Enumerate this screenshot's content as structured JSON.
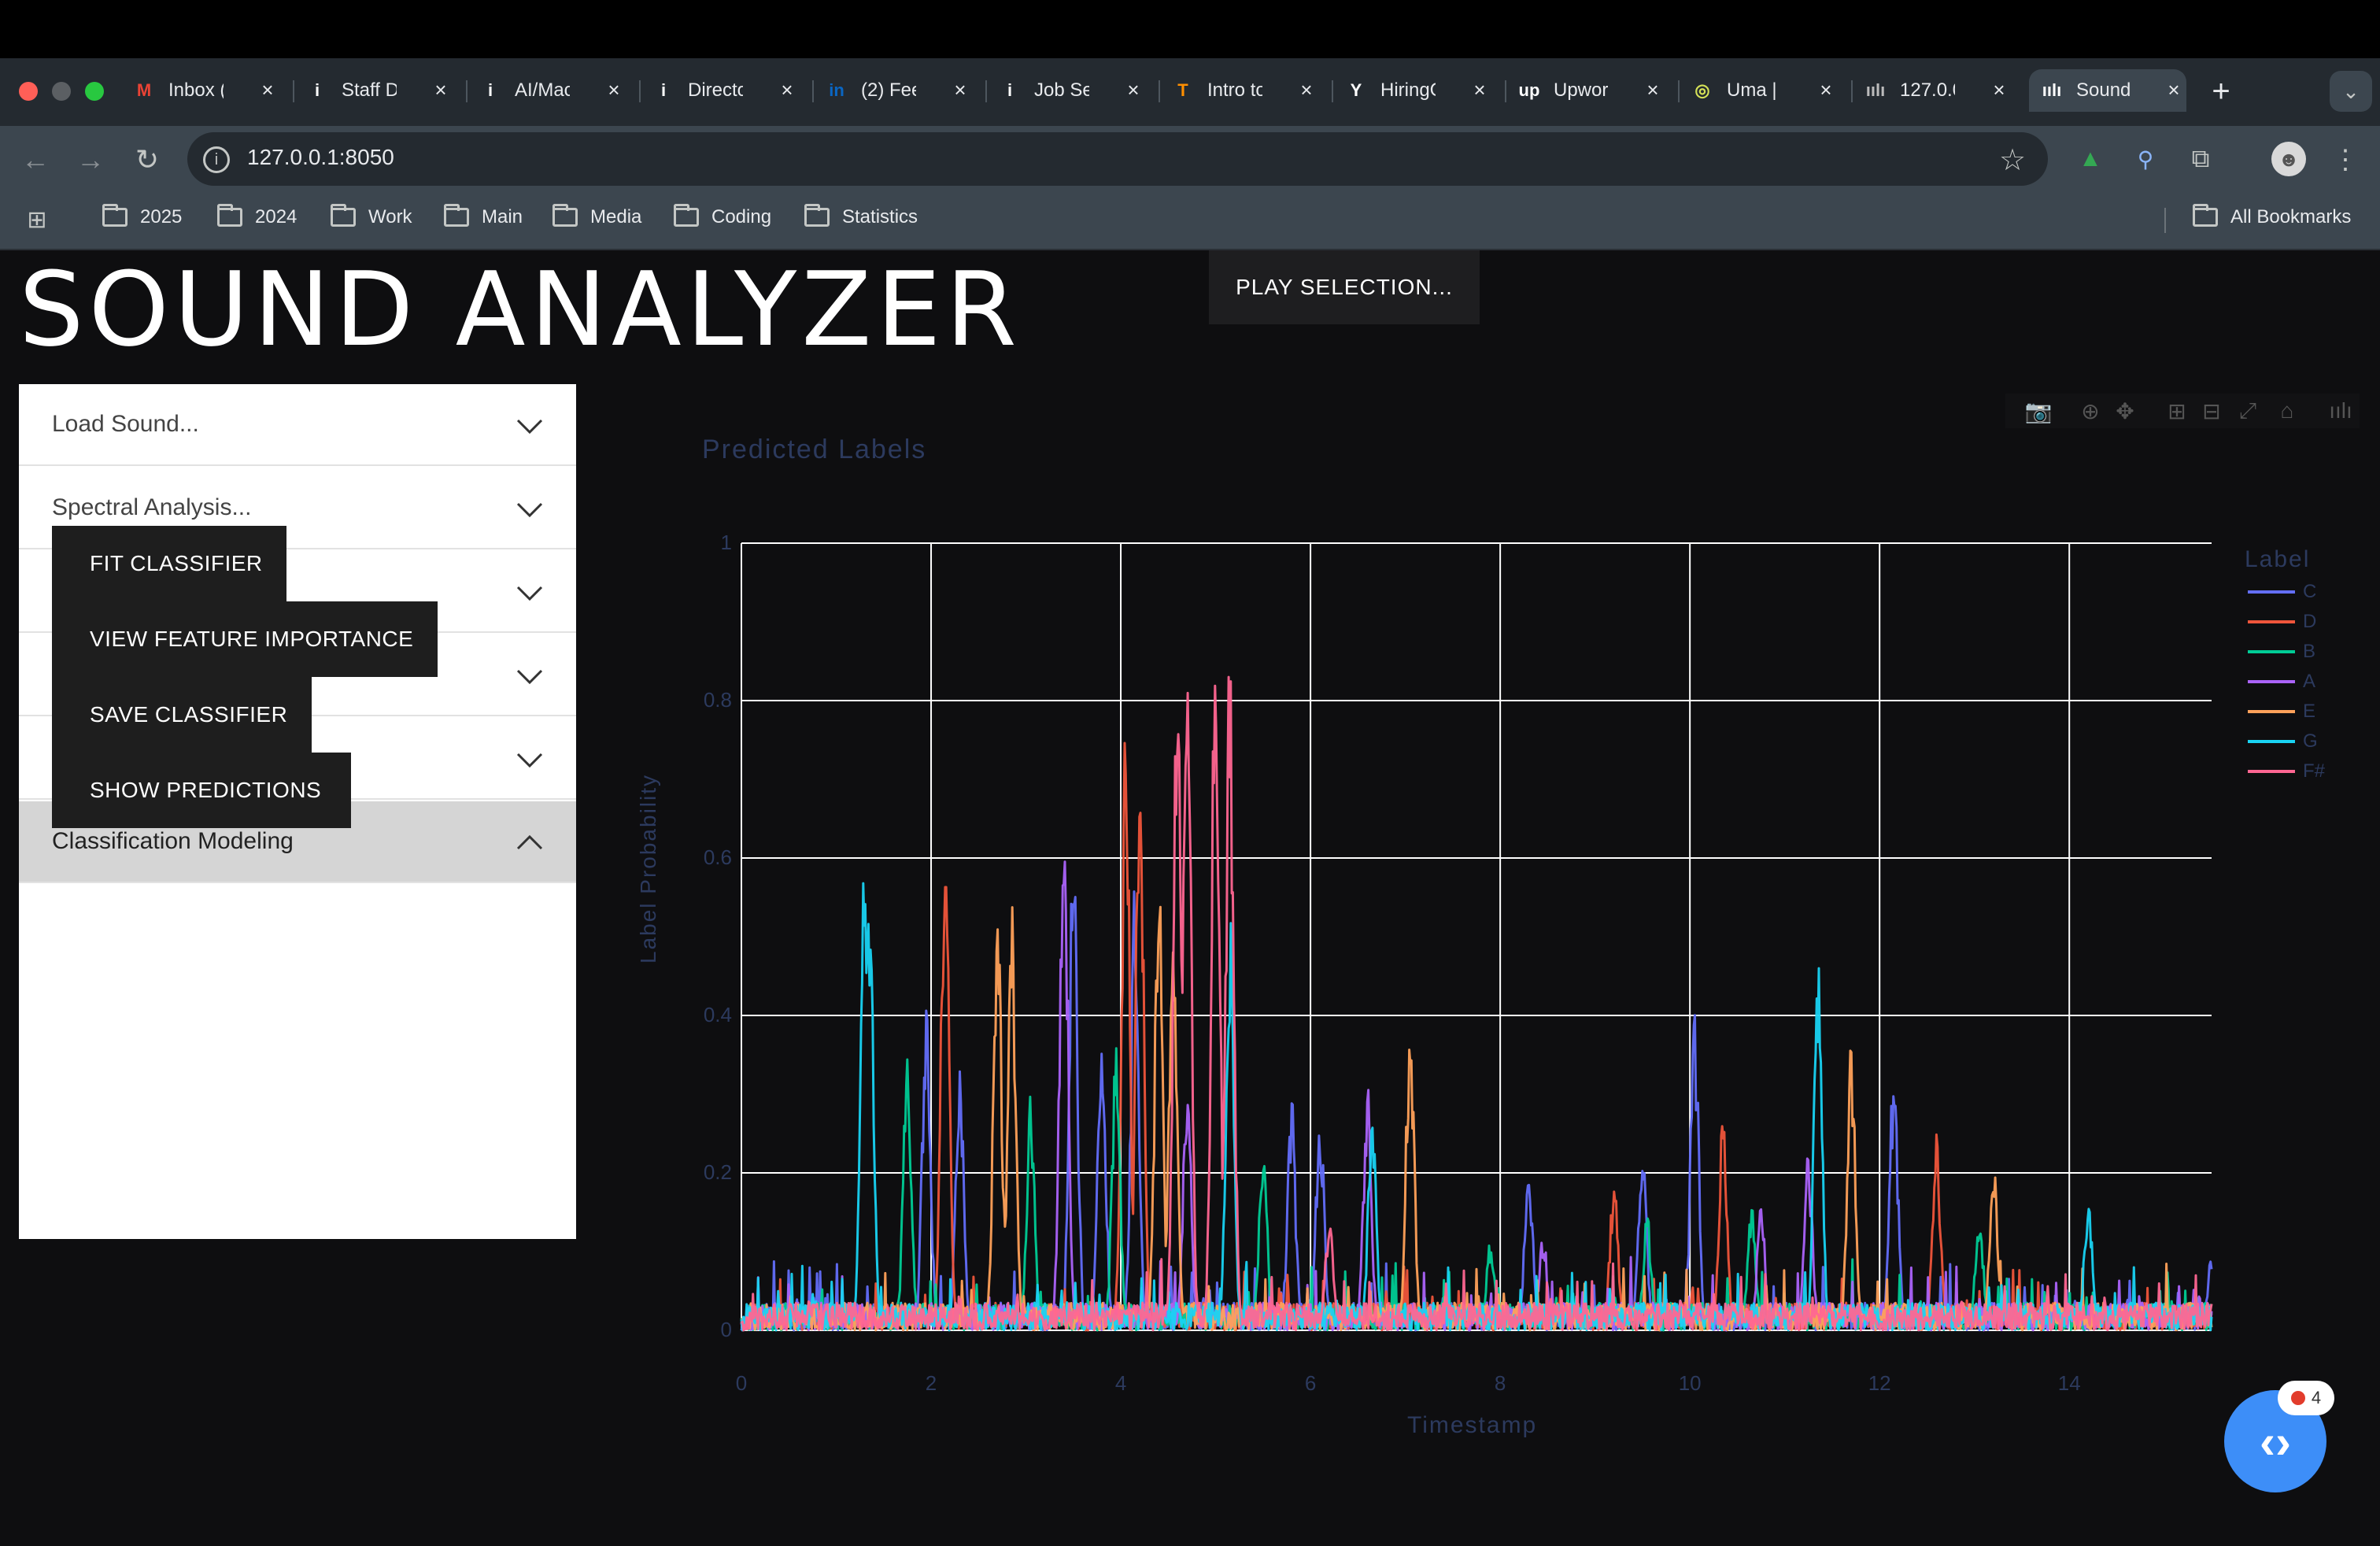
{
  "browser": {
    "tabs": [
      {
        "label": "Inbox (",
        "icon": "gmail-icon",
        "glyph": "M",
        "color": "#ea4335"
      },
      {
        "label": "Staff D",
        "icon": "info-icon",
        "glyph": "i",
        "color": "#ffffff"
      },
      {
        "label": "AI/Mac",
        "icon": "info-icon",
        "glyph": "i",
        "color": "#ffffff"
      },
      {
        "label": "Directo",
        "icon": "info-icon",
        "glyph": "i",
        "color": "#ffffff"
      },
      {
        "label": "(2) Fee",
        "icon": "linkedin-icon",
        "glyph": "in",
        "color": "#0a66c2"
      },
      {
        "label": "Job Se",
        "icon": "info-icon",
        "glyph": "i",
        "color": "#ffffff"
      },
      {
        "label": "Intro to",
        "icon": "tensorflow-icon",
        "glyph": "T",
        "color": "#ff8f00"
      },
      {
        "label": "HiringC",
        "icon": "y-icon",
        "glyph": "Y",
        "color": "#ffffff"
      },
      {
        "label": "Upwork",
        "icon": "upwork-icon",
        "glyph": "up",
        "color": "#ffffff"
      },
      {
        "label": "Uma | U",
        "icon": "uma-icon",
        "glyph": "◎",
        "color": "#d4e157"
      },
      {
        "label": "127.0.0",
        "icon": "bars-icon",
        "glyph": "ıılı",
        "color": "#bbbbbb"
      },
      {
        "label": "Sound",
        "icon": "bars-icon",
        "glyph": "ıılı",
        "color": "#ffffff",
        "active": true
      }
    ],
    "url": "127.0.0.1:8050",
    "bookmarks": [
      "2025",
      "2024",
      "Work",
      "Main",
      "Media",
      "Coding",
      "Statistics"
    ],
    "all_bookmarks": "All Bookmarks"
  },
  "app": {
    "title": "SOUND ANALYZER",
    "play_selection": "PLAY SELECTION...",
    "accordion": [
      {
        "label": "Load Sound...",
        "open": false
      },
      {
        "label": "Spectral Analysis...",
        "open": false
      },
      {
        "label": "Data Labeling...",
        "open": false
      },
      {
        "label": "Dimension Reduction...",
        "open": false
      },
      {
        "label": "Clustering...",
        "open": false
      },
      {
        "label": "Classification Modeling",
        "open": true
      }
    ],
    "actions": [
      "FIT CLASSIFIER",
      "VIEW FEATURE IMPORTANCE",
      "SAVE CLASSIFIER",
      "SHOW PREDICTIONS"
    ],
    "fab_badge": "4"
  },
  "chart_data": {
    "type": "line",
    "title": "Predicted Labels",
    "xlabel": "Timestamp",
    "ylabel": "Label Probability",
    "xlim": [
      0,
      15.5
    ],
    "ylim": [
      0,
      1
    ],
    "x_ticks": [
      "0",
      "2",
      "4",
      "6",
      "8",
      "10",
      "12",
      "14"
    ],
    "y_ticks": [
      "0",
      "0.2",
      "0.4",
      "0.6",
      "0.8",
      "1"
    ],
    "legend_title": "Label",
    "legend_position": "right",
    "grid": true,
    "series": [
      {
        "name": "C",
        "color": "#636efa",
        "peaks": [
          [
            1.95,
            0.45
          ],
          [
            2.3,
            0.35
          ],
          [
            3.5,
            0.65
          ],
          [
            3.8,
            0.4
          ],
          [
            4.15,
            0.58
          ],
          [
            5.8,
            0.3
          ],
          [
            6.1,
            0.29
          ],
          [
            8.3,
            0.22
          ],
          [
            9.5,
            0.25
          ],
          [
            10.05,
            0.42
          ],
          [
            12.15,
            0.35
          ],
          [
            15.5,
            0.1
          ]
        ]
      },
      {
        "name": "D",
        "color": "#ef553b",
        "peaks": [
          [
            2.15,
            0.71
          ],
          [
            4.05,
            0.81
          ],
          [
            4.2,
            0.8
          ],
          [
            9.2,
            0.2
          ],
          [
            10.35,
            0.28
          ],
          [
            12.6,
            0.25
          ]
        ]
      },
      {
        "name": "B",
        "color": "#00cc96",
        "peaks": [
          [
            1.75,
            0.38
          ],
          [
            3.05,
            0.3
          ],
          [
            3.95,
            0.37
          ],
          [
            5.5,
            0.25
          ],
          [
            7.9,
            0.12
          ],
          [
            9.55,
            0.15
          ],
          [
            10.65,
            0.17
          ],
          [
            13.05,
            0.16
          ]
        ]
      },
      {
        "name": "A",
        "color": "#ab63fa",
        "peaks": [
          [
            3.4,
            0.72
          ],
          [
            4.7,
            0.34
          ],
          [
            6.6,
            0.32
          ],
          [
            8.45,
            0.13
          ],
          [
            10.75,
            0.16
          ],
          [
            11.25,
            0.23
          ]
        ]
      },
      {
        "name": "E",
        "color": "#ffa15a",
        "peaks": [
          [
            2.7,
            0.6
          ],
          [
            2.85,
            0.55
          ],
          [
            4.4,
            0.6
          ],
          [
            4.55,
            0.55
          ],
          [
            7.05,
            0.42
          ],
          [
            11.7,
            0.37
          ],
          [
            13.2,
            0.22
          ]
        ]
      },
      {
        "name": "G",
        "color": "#19d3f3",
        "peaks": [
          [
            1.3,
            0.63
          ],
          [
            1.35,
            0.57
          ],
          [
            5.15,
            0.53
          ],
          [
            6.65,
            0.28
          ],
          [
            11.35,
            0.48
          ],
          [
            14.2,
            0.18
          ]
        ]
      },
      {
        "name": "F#",
        "color": "#ff6692",
        "peaks": [
          [
            4.6,
            0.95
          ],
          [
            4.7,
            0.9
          ],
          [
            5.0,
            0.93
          ],
          [
            5.15,
            0.88
          ],
          [
            6.2,
            0.15
          ]
        ]
      }
    ]
  }
}
